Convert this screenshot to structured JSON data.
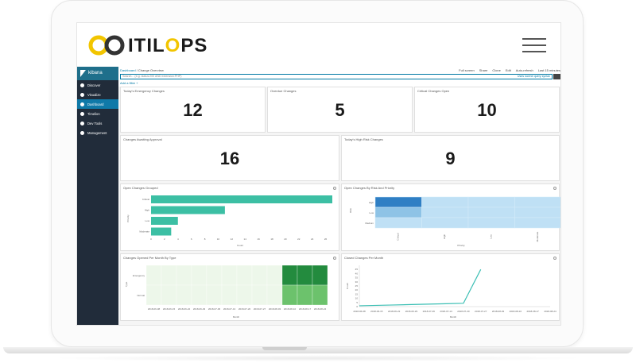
{
  "brand": {
    "name": "ITILOPS",
    "name_prefix": "ITIL",
    "name_o": "O",
    "name_suffix": "PS",
    "accent": "#f2c500"
  },
  "kibana": {
    "logo": "kibana",
    "nav": [
      {
        "label": "Discover",
        "icon": "compass-icon"
      },
      {
        "label": "Visualize",
        "icon": "chart-icon"
      },
      {
        "label": "Dashboard",
        "icon": "dashboard-icon",
        "active": true
      },
      {
        "label": "Timelion",
        "icon": "timelion-icon"
      },
      {
        "label": "Dev Tools",
        "icon": "wrench-icon"
      },
      {
        "label": "Management",
        "icon": "gear-icon"
      }
    ]
  },
  "topbar": {
    "breadcrumb_root": "Dashboard",
    "breadcrumb_current": "Change Overview",
    "actions": [
      "Full screen",
      "Share",
      "Clone",
      "Edit",
      "Auto-refresh",
      "Last 15 minutes"
    ]
  },
  "search": {
    "placeholder": "Search... (e.g. status:200 AND extension:PHP)",
    "lucene": "Uses lucene query syntax"
  },
  "filter": {
    "label": "Add a filter +"
  },
  "metrics": [
    {
      "title": "Today's Emergency Changes",
      "value": "12"
    },
    {
      "title": "Overdue Changes",
      "value": "5"
    },
    {
      "title": "Critical Changes Open",
      "value": "10"
    },
    {
      "title": "Changes Awaiting Approval",
      "value": "16"
    },
    {
      "title": "Today's High Risk Changes",
      "value": "9"
    }
  ],
  "charts": {
    "open_grouped": {
      "title": "Open Changes Grouped",
      "ylabel": "Priority",
      "xlabel": "Count"
    },
    "risk_priority": {
      "title": "Open Changes By Risk And Priority",
      "ylabel": "Risk",
      "xlabel": "Priority"
    },
    "opened_per_month": {
      "title": "Changes Opened Per Month By Type",
      "ylabel": "Type",
      "xlabel": "Month"
    },
    "closed_per_month": {
      "title": "Closed Changes Per Month",
      "ylabel": "Count",
      "xlabel": "Month"
    }
  },
  "chart_data": [
    {
      "type": "bar",
      "orientation": "horizontal",
      "title": "Open Changes Grouped",
      "xlabel": "Count",
      "ylabel": "Priority",
      "categories": [
        "Critical",
        "High",
        "Low",
        "Moderate"
      ],
      "values": [
        27,
        11,
        4,
        3
      ],
      "xticks": [
        "0",
        "2",
        "4",
        "6",
        "8",
        "10",
        "12",
        "14",
        "16",
        "18",
        "20",
        "22",
        "24",
        "26"
      ],
      "xlim": [
        0,
        27
      ],
      "color": "#3cbfa4"
    },
    {
      "type": "heatmap",
      "title": "Open Changes By Risk And Priority",
      "xlabel": "Priority",
      "ylabel": "Risk",
      "x": [
        "Critical",
        "High",
        "Low",
        "Moderate"
      ],
      "y": [
        "High",
        "Low",
        "Medium"
      ],
      "values": [
        [
          4,
          1,
          1,
          1
        ],
        [
          2,
          1,
          1,
          1
        ],
        [
          1,
          1,
          1,
          1
        ]
      ],
      "colors": [
        "#bfe0f5",
        "#8ec3e6",
        "#2f7fc4"
      ]
    },
    {
      "type": "heatmap",
      "title": "Changes Opened Per Month By Type",
      "xlabel": "Month",
      "ylabel": "Type",
      "x": [
        "2018-06-08",
        "2018-06-15",
        "2018-06-22",
        "2018-06-29",
        "2018-07-06",
        "2018-07-13",
        "2018-07-20",
        "2018-07-27",
        "2018-08-03",
        "2018-08-10",
        "2018-08-17",
        "2018-08-24"
      ],
      "y": [
        "Emergency",
        "Normal"
      ],
      "values": [
        [
          0,
          0,
          0,
          0,
          0,
          0,
          0,
          0,
          0,
          2,
          2,
          2
        ],
        [
          0,
          0,
          0,
          0,
          0,
          0,
          0,
          0,
          0,
          1,
          1,
          1
        ]
      ],
      "colors": [
        "#edf7ea",
        "#6cc26c",
        "#238b3e"
      ]
    },
    {
      "type": "line",
      "title": "Closed Changes Per Month",
      "xlabel": "Month",
      "ylabel": "Count",
      "x": [
        "2018-06-08",
        "2018-06-15",
        "2018-06-22",
        "2018-06-29",
        "2018-07-06",
        "2018-07-13",
        "2018-07-20",
        "2018-07-27",
        "2018-08-03",
        "2018-08-10",
        "2018-08-17",
        "2018-08-24"
      ],
      "y": [
        1,
        1.5,
        2,
        2.5,
        3,
        3.5,
        4,
        45,
        null,
        null,
        null,
        null
      ],
      "yticks": [
        "0",
        "5",
        "10",
        "15",
        "20",
        "25",
        "30",
        "35",
        "40",
        "45"
      ],
      "ylim": [
        0,
        50
      ],
      "color": "#3cbfb4"
    }
  ]
}
